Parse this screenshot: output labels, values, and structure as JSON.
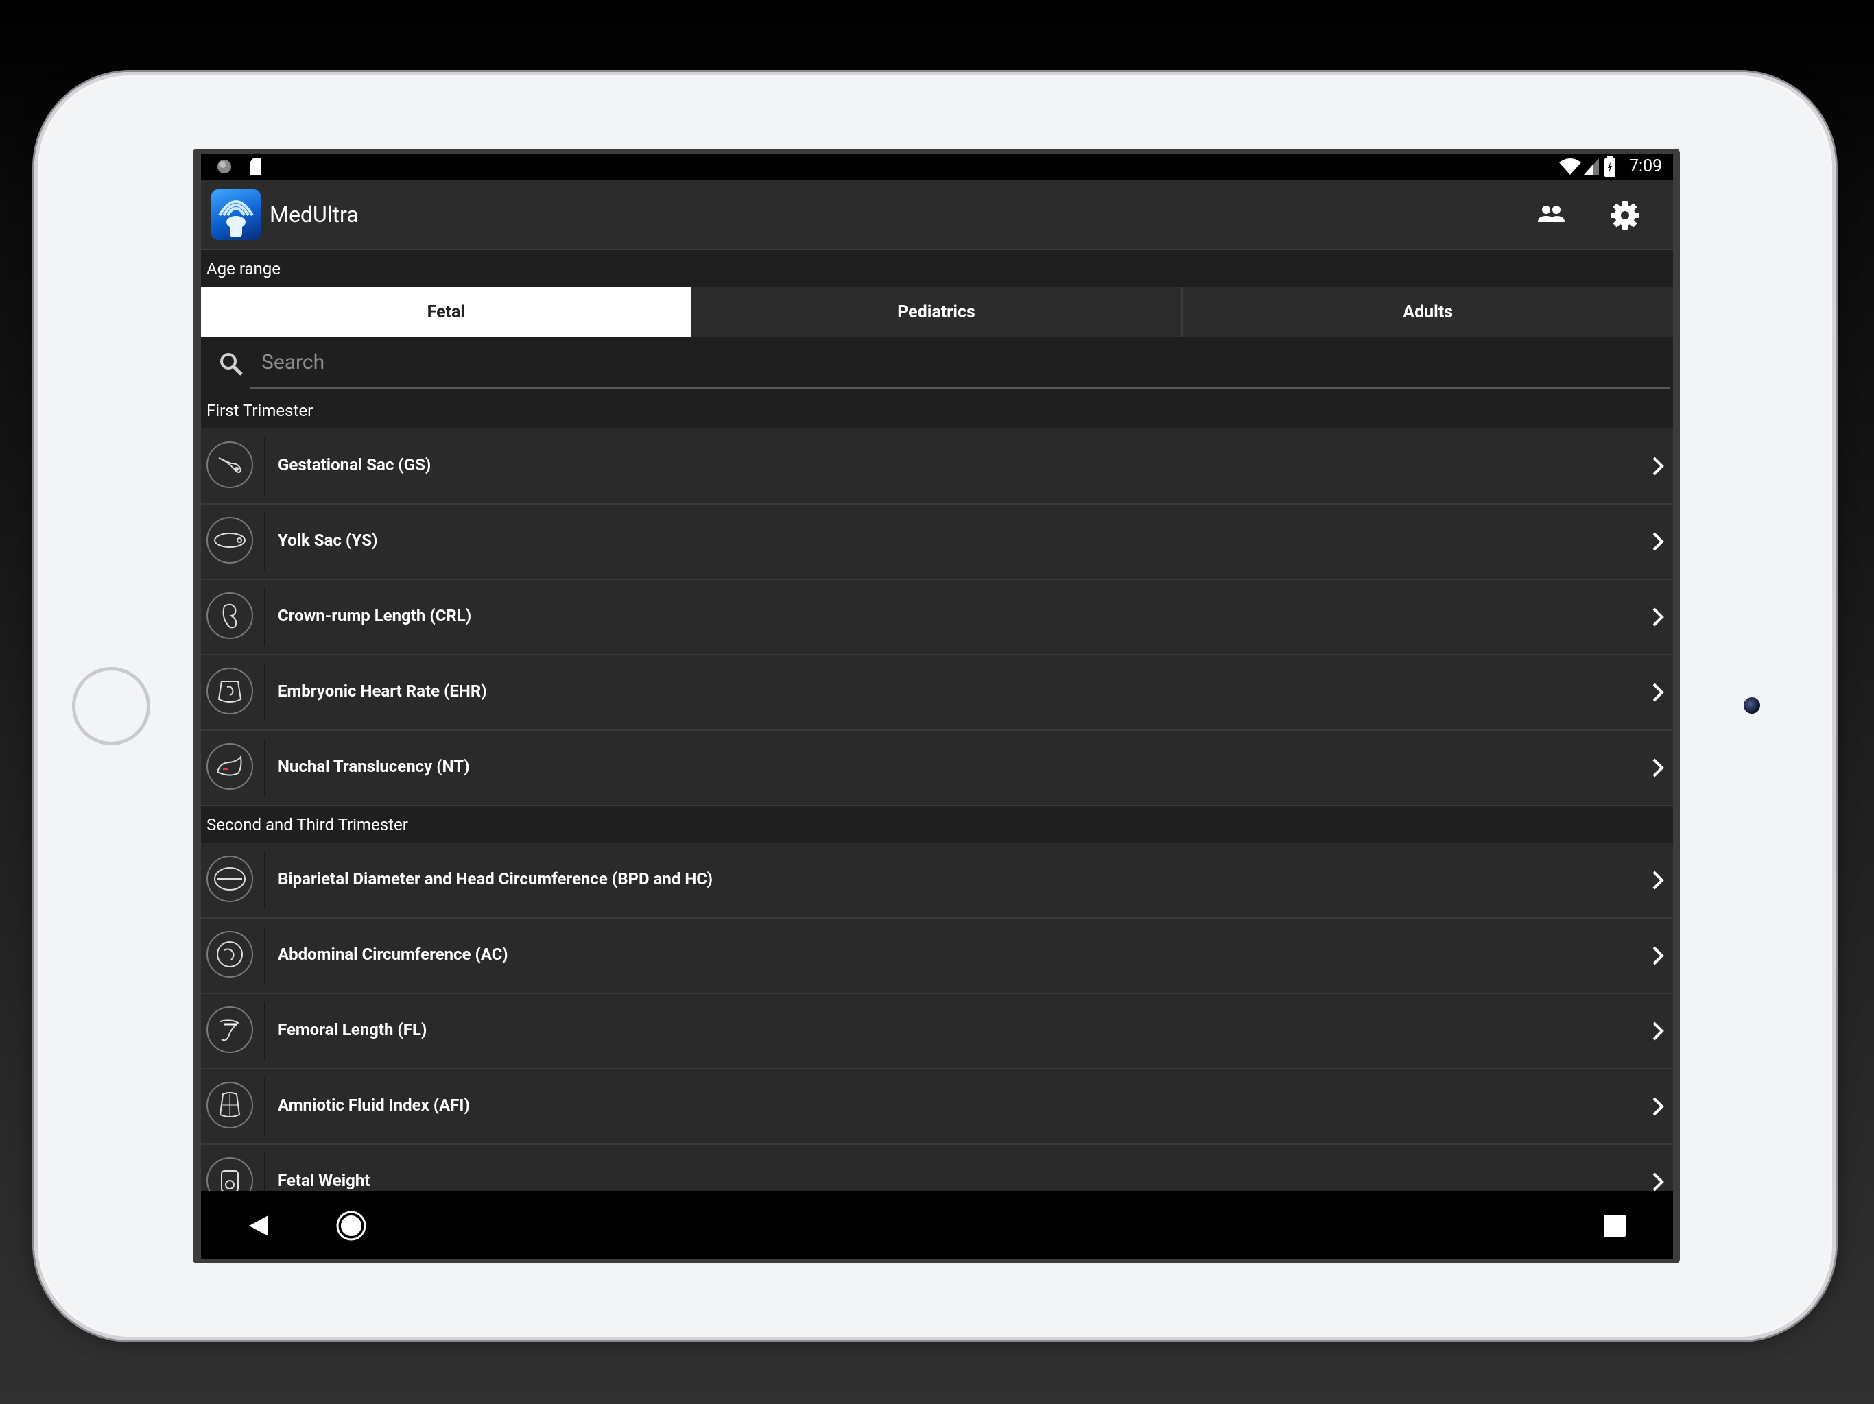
{
  "status_bar": {
    "time": "7:09"
  },
  "app_bar": {
    "title": "MedUltra",
    "contacts_icon": "people-icon",
    "settings_icon": "gear-icon"
  },
  "age_range": {
    "label": "Age range",
    "tabs": [
      {
        "label": "Fetal",
        "selected": true
      },
      {
        "label": "Pediatrics",
        "selected": false
      },
      {
        "label": "Adults",
        "selected": false
      }
    ]
  },
  "search": {
    "placeholder": "Search"
  },
  "sections": [
    {
      "title": "First Trimester",
      "items": [
        {
          "label": "Gestational Sac (GS)"
        },
        {
          "label": "Yolk Sac (YS)"
        },
        {
          "label": "Crown-rump Length (CRL)"
        },
        {
          "label": "Embryonic Heart Rate (EHR)"
        },
        {
          "label": "Nuchal Translucency (NT)"
        }
      ]
    },
    {
      "title": "Second and Third Trimester",
      "items": [
        {
          "label": "Biparietal Diameter and Head Circumference (BPD and HC)"
        },
        {
          "label": "Abdominal Circumference (AC)"
        },
        {
          "label": "Femoral Length (FL)"
        },
        {
          "label": "Amniotic Fluid Index (AFI)"
        },
        {
          "label": "Fetal Weight"
        }
      ]
    }
  ],
  "colors": {
    "background": "#2a2a2a",
    "section_header": "#1f1f1f",
    "tab_active": "#ffffff",
    "text": "#ffffff"
  }
}
